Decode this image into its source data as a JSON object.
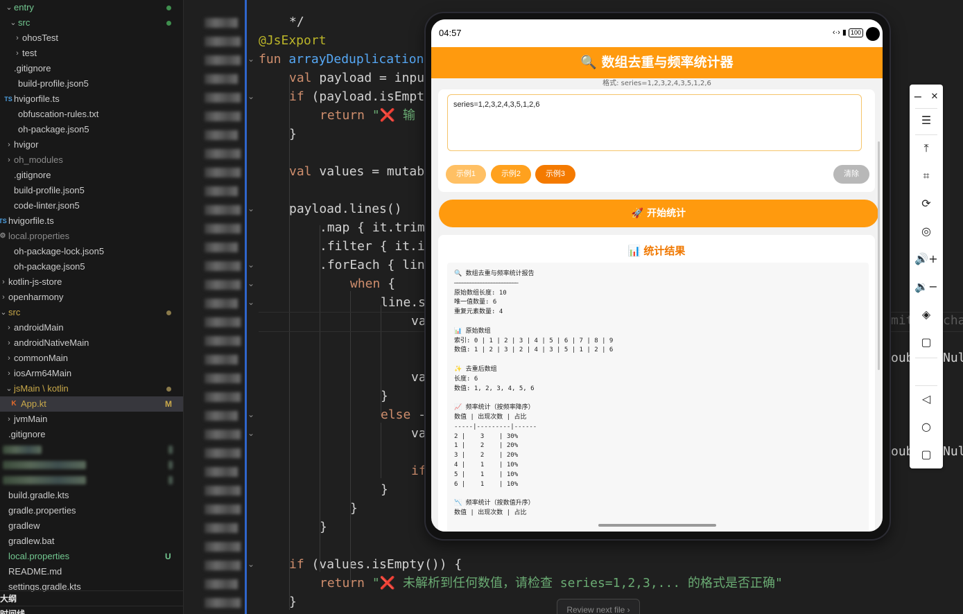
{
  "explorer": {
    "rows": [
      {
        "label": "entry",
        "color": "#73c991",
        "dot": "#3f8f4e",
        "chev": "⌄"
      },
      {
        "label": "src",
        "color": "#73c991",
        "dot": "#3f8f4e",
        "chev": "⌄"
      },
      {
        "label": "ohosTest",
        "color": "#cccccc",
        "chev": "›"
      },
      {
        "label": "test",
        "color": "#cccccc",
        "chev": "›"
      },
      {
        "label": ".gitignore",
        "color": "#cccccc"
      },
      {
        "label": "build-profile.json5",
        "color": "#cccccc"
      },
      {
        "label": "hvigorfile.ts",
        "color": "#cccccc",
        "icon": "TS"
      },
      {
        "label": "obfuscation-rules.txt",
        "color": "#cccccc"
      },
      {
        "label": "oh-package.json5",
        "color": "#cccccc"
      },
      {
        "label": "hvigor",
        "color": "#cccccc",
        "chev": "›"
      },
      {
        "label": "oh_modules",
        "color": "#8b8b8b",
        "chev": "›"
      },
      {
        "label": ".gitignore",
        "color": "#cccccc"
      },
      {
        "label": "build-profile.json5",
        "color": "#cccccc"
      },
      {
        "label": "code-linter.json5",
        "color": "#cccccc"
      },
      {
        "label": "hvigorfile.ts",
        "color": "#cccccc",
        "icon": "TS"
      },
      {
        "label": "local.properties",
        "color": "#8b8b8b",
        "icon": "gear"
      },
      {
        "label": "oh-package-lock.json5",
        "color": "#cccccc"
      },
      {
        "label": "oh-package.json5",
        "color": "#cccccc"
      },
      {
        "label": "kotlin-js-store",
        "color": "#cccccc",
        "chev": "›"
      },
      {
        "label": "openharmony",
        "color": "#cccccc",
        "chev": "›"
      },
      {
        "label": "src",
        "color": "#c9a94a",
        "dot": "#8a7a4a",
        "chev": "⌄"
      },
      {
        "label": "androidMain",
        "color": "#cccccc",
        "chev": "›"
      },
      {
        "label": "androidNativeMain",
        "color": "#cccccc",
        "chev": "›"
      },
      {
        "label": "commonMain",
        "color": "#cccccc",
        "chev": "›"
      },
      {
        "label": "iosArm64Main",
        "color": "#cccccc",
        "chev": "›"
      },
      {
        "label": "jsMain \\ kotlin",
        "color": "#c9a94a",
        "dot": "#8a7a4a",
        "chev": "⌄"
      },
      {
        "label": "App.kt",
        "color": "#c9a94a",
        "badge": "M",
        "icon": "K",
        "selected": true
      },
      {
        "label": "jvmMain",
        "color": "#cccccc",
        "chev": "›"
      },
      {
        "label": ".gitignore",
        "color": "#cccccc"
      },
      {
        "label": "",
        "blurred": true
      },
      {
        "label": "",
        "blurred": true
      },
      {
        "label": "",
        "blurred": true
      },
      {
        "label": "build.gradle.kts",
        "color": "#cccccc"
      },
      {
        "label": "gradle.properties",
        "color": "#cccccc"
      },
      {
        "label": "gradlew",
        "color": "#cccccc"
      },
      {
        "label": "gradlew.bat",
        "color": "#cccccc"
      },
      {
        "label": "local.properties",
        "color": "#73c991",
        "badge": "U",
        "badgeColor": "#73c991"
      },
      {
        "label": "README.md",
        "color": "#cccccc"
      },
      {
        "label": "settings.gradle.kts",
        "color": "#cccccc"
      }
    ],
    "outline_label": "大纲",
    "timeline_label": "时间线"
  },
  "editor": {
    "code_lines": [
      {
        "indent": 1,
        "html": "*/",
        "cls": ""
      },
      {
        "indent": 0,
        "text": "@JsExport",
        "cls": "ann"
      },
      {
        "indent": 0,
        "parts": [
          [
            "kw",
            "fun "
          ],
          [
            "fn",
            "arrayDeduplication"
          ]
        ]
      },
      {
        "indent": 1,
        "parts": [
          [
            "kw",
            "val "
          ],
          [
            "",
            "payload = inpu"
          ]
        ]
      },
      {
        "indent": 1,
        "parts": [
          [
            "kw",
            "if "
          ],
          [
            "",
            "(payload.isEmpt"
          ]
        ]
      },
      {
        "indent": 2,
        "parts": [
          [
            "kw",
            "return "
          ],
          [
            "str",
            "\"❌ 输"
          ]
        ]
      },
      {
        "indent": 1,
        "parts": [
          [
            "",
            "}"
          ]
        ]
      },
      {
        "indent": 0,
        "parts": [
          [
            "",
            ""
          ]
        ]
      },
      {
        "indent": 1,
        "parts": [
          [
            "kw",
            "val "
          ],
          [
            "",
            "values = mutab"
          ]
        ]
      },
      {
        "indent": 0,
        "parts": [
          [
            "",
            ""
          ]
        ]
      },
      {
        "indent": 1,
        "parts": [
          [
            "",
            "payload.lines()"
          ]
        ]
      },
      {
        "indent": 2,
        "parts": [
          [
            "",
            ".map { it.trim"
          ]
        ]
      },
      {
        "indent": 2,
        "parts": [
          [
            "",
            ".filter { it.i"
          ]
        ]
      },
      {
        "indent": 2,
        "parts": [
          [
            "",
            ".forEach { lin"
          ]
        ]
      },
      {
        "indent": 3,
        "parts": [
          [
            "kw",
            "when "
          ],
          [
            "",
            "{"
          ]
        ]
      },
      {
        "indent": 4,
        "parts": [
          [
            "",
            "line.s"
          ]
        ]
      },
      {
        "indent": 5,
        "parts": [
          [
            "",
            "va"
          ]
        ]
      },
      {
        "indent": 0,
        "parts": [
          [
            "",
            ""
          ]
        ]
      },
      {
        "indent": 0,
        "parts": [
          [
            "",
            ""
          ]
        ]
      },
      {
        "indent": 5,
        "parts": [
          [
            "",
            "va"
          ]
        ]
      },
      {
        "indent": 4,
        "parts": [
          [
            "",
            "}"
          ]
        ]
      },
      {
        "indent": 4,
        "parts": [
          [
            "kw",
            "else "
          ],
          [
            "",
            "-"
          ]
        ]
      },
      {
        "indent": 5,
        "parts": [
          [
            "",
            "va"
          ]
        ]
      },
      {
        "indent": 0,
        "parts": [
          [
            "",
            ""
          ]
        ]
      },
      {
        "indent": 5,
        "parts": [
          [
            "kw",
            "if"
          ]
        ]
      },
      {
        "indent": 4,
        "parts": [
          [
            "",
            "}"
          ]
        ]
      },
      {
        "indent": 3,
        "parts": [
          [
            "",
            "}"
          ]
        ]
      },
      {
        "indent": 2,
        "parts": [
          [
            "",
            "}"
          ]
        ]
      },
      {
        "indent": 0,
        "parts": [
          [
            "",
            ""
          ]
        ]
      },
      {
        "indent": 1,
        "parts": [
          [
            "kw",
            "if "
          ],
          [
            "",
            "(values.isEmpty()) {"
          ]
        ]
      },
      {
        "indent": 2,
        "parts": [
          [
            "kw",
            "return "
          ],
          [
            "str",
            "\"❌ 未解析到任何数值，请检查 series=1,2,3,... 的格式是否正确\""
          ]
        ]
      },
      {
        "indent": 1,
        "parts": [
          [
            "",
            "}"
          ]
        ]
      }
    ],
    "ghost_right_1": "mit",
    "ghost_right_2": "cha",
    "ghost_right_3": "oub",
    "ghost_right_4": "Nul",
    "review_label": "Review next file  ›"
  },
  "phone": {
    "status_time": "04:57",
    "status_icons": "‹·› ▮",
    "battery": "100",
    "title": "🔍 数组去重与频率统计器",
    "format_hint": "格式: series=1,2,3,2,4,3,5,1,2,6",
    "input_value": "series=1,2,3,2,4,3,5,1,2,6",
    "chips": [
      "示例1",
      "示例2",
      "示例3"
    ],
    "clear_label": "清除",
    "start_label": "🚀 开始统计",
    "result_title": "📊 统计结果",
    "report_lines": [
      "🔍 数组去重与频率统计报告",
      "────────────────────────",
      "原始数组长度: 10",
      "唯一值数量: 6",
      "重复元素数量: 4",
      "",
      "📊 原始数组",
      "索引: 0 | 1 | 2 | 3 | 4 | 5 | 6 | 7 | 8 | 9",
      "数值: 1 | 2 | 3 | 2 | 4 | 3 | 5 | 1 | 2 | 6",
      "",
      "✨ 去重后数组",
      "长度: 6",
      "数值: 1, 2, 3, 4, 5, 6",
      "",
      "📈 频率统计（按频率降序）",
      "数值 | 出现次数 | 占比",
      "-----|---------|------",
      "2 |    3    | 30%",
      "1 |    2    | 20%",
      "3 |    2    | 20%",
      "4 |    1    | 10%",
      "5 |    1    | 10%",
      "6 |    1    | 10%",
      "",
      "📉 频率统计（按数值升序）",
      "数值 | 出现次数 | 占比"
    ]
  },
  "toolbar": {
    "items": [
      {
        "name": "minimize-button",
        "glyph": "−"
      },
      {
        "name": "close-button",
        "glyph": "✕"
      },
      {
        "name": "menu-icon",
        "glyph": "☰"
      },
      {
        "name": "pin-top-icon",
        "glyph": "⤒"
      },
      {
        "name": "crop-screenshot-icon",
        "glyph": "⌗"
      },
      {
        "name": "rotate-icon",
        "glyph": "⟳"
      },
      {
        "name": "location-icon",
        "glyph": "◎"
      },
      {
        "name": "volume-up-icon",
        "glyph": "🔊+"
      },
      {
        "name": "volume-down-icon",
        "glyph": "🔉−"
      },
      {
        "name": "fold-rotate-icon",
        "glyph": "◈"
      },
      {
        "name": "square-frame-icon",
        "glyph": "▢"
      },
      {
        "name": "back-icon",
        "glyph": "◁"
      },
      {
        "name": "home-icon",
        "glyph": "○"
      },
      {
        "name": "recents-icon",
        "glyph": "▢"
      }
    ]
  }
}
